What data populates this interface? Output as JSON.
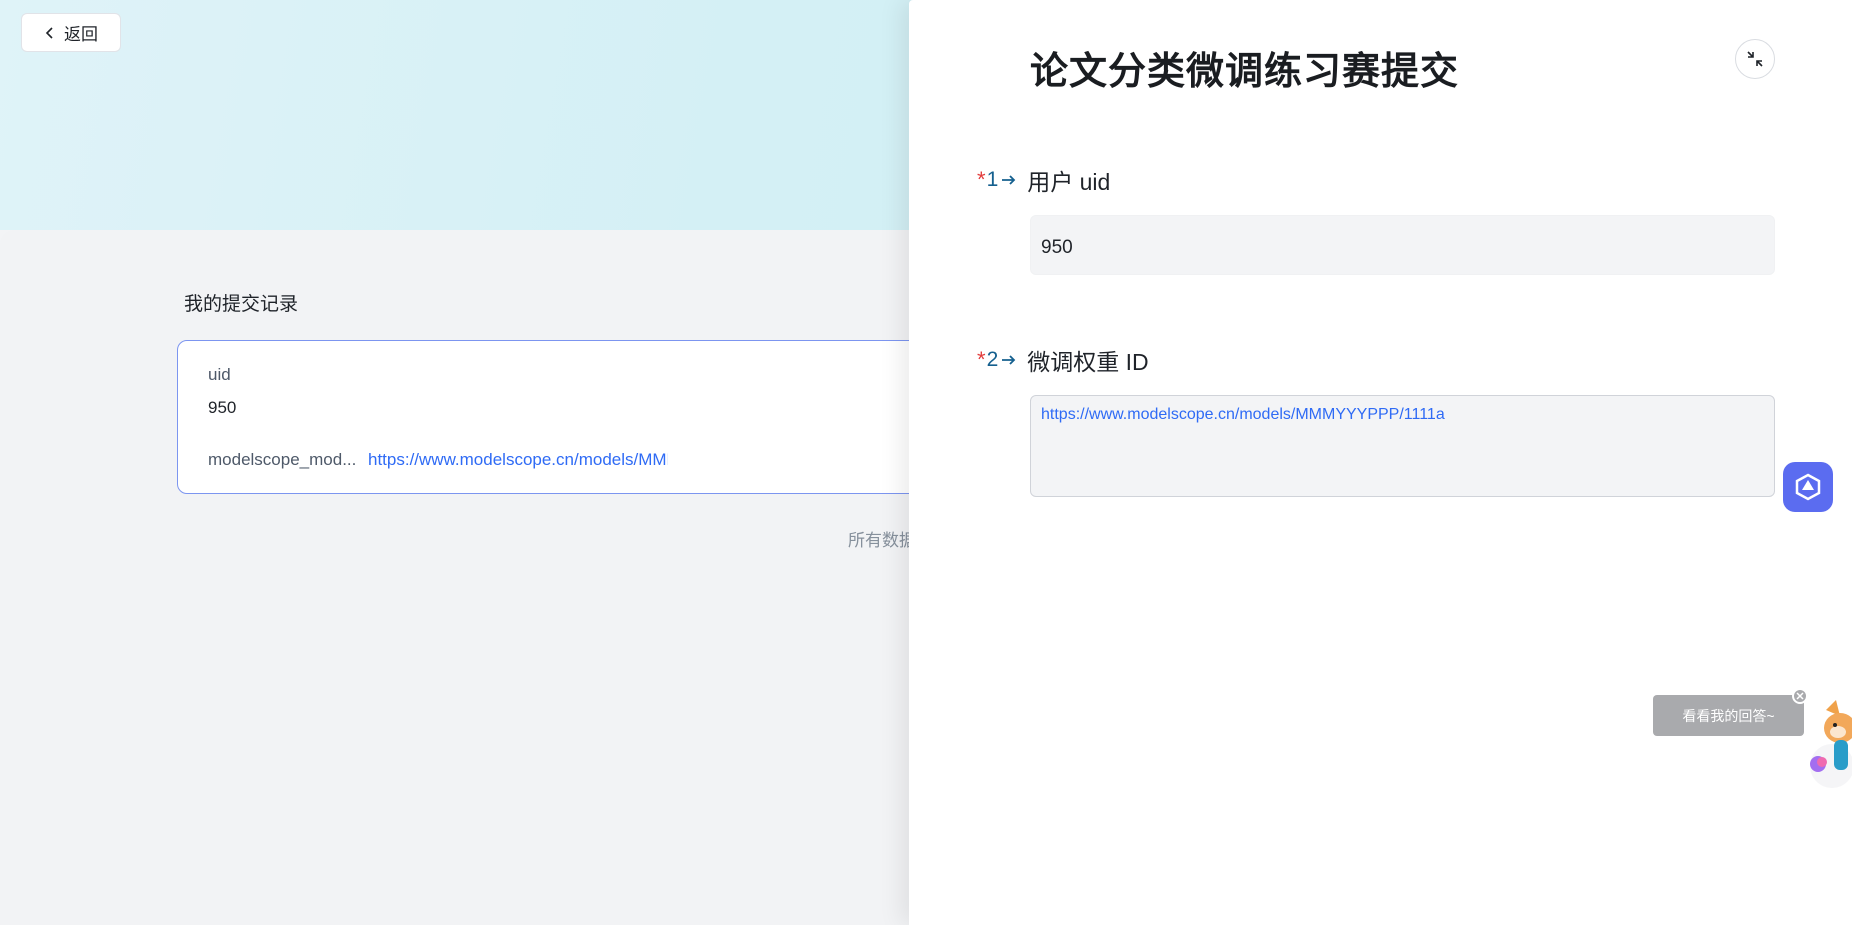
{
  "page": {
    "back_label": "返回",
    "records_title": "我的提交记录",
    "footer_note": "所有数据"
  },
  "record": {
    "uid_label": "uid",
    "uid_value": "950",
    "model_key": "modelscope_mod...",
    "model_link": "https://www.modelscope.cn/models/MMMYYYPPP/1111a"
  },
  "drawer": {
    "title": "论文分类微调练习赛提交",
    "questions": [
      {
        "required_mark": "*",
        "number": "1",
        "label": "用户 uid",
        "value": "950"
      },
      {
        "required_mark": "*",
        "number": "2",
        "label": "微调权重 ID",
        "value": "https://www.modelscope.cn/models/MMMYYYPPP/1111a"
      }
    ]
  },
  "widgets": {
    "tip_text": "看看我的回答~",
    "ai_icon": "ai-assistant-icon",
    "accent_color": "#5b6cf0"
  }
}
